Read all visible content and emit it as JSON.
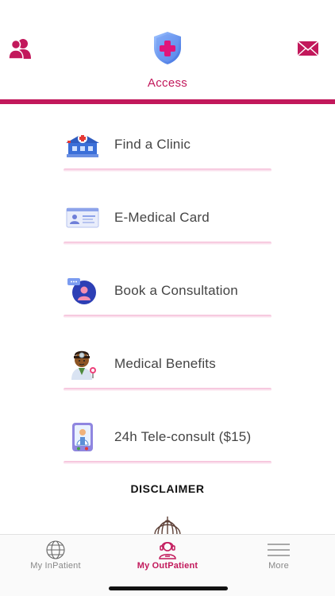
{
  "header": {
    "title": "Access",
    "accent_color": "#c2185b",
    "left_icon": "profile-group-icon",
    "right_icon": "mail-icon",
    "logo_icon": "medical-shield-icon"
  },
  "menu": {
    "items": [
      {
        "label": "Find a Clinic",
        "icon": "clinic-building-icon"
      },
      {
        "label": "E-Medical Card",
        "icon": "id-card-icon"
      },
      {
        "label": "Book a Consultation",
        "icon": "chat-consultation-icon"
      },
      {
        "label": "Medical Benefits",
        "icon": "doctor-icon"
      },
      {
        "label": "24h Tele-consult ($15)",
        "icon": "phone-doctor-icon"
      }
    ]
  },
  "disclaimer": {
    "label": "DISCLAIMER"
  },
  "tabbar": {
    "tabs": [
      {
        "label": "My InPatient",
        "icon": "globe-icon",
        "active": false
      },
      {
        "label": "My OutPatient",
        "icon": "headset-person-icon",
        "active": true
      },
      {
        "label": "More",
        "icon": "hamburger-menu-icon",
        "active": false
      }
    ]
  }
}
